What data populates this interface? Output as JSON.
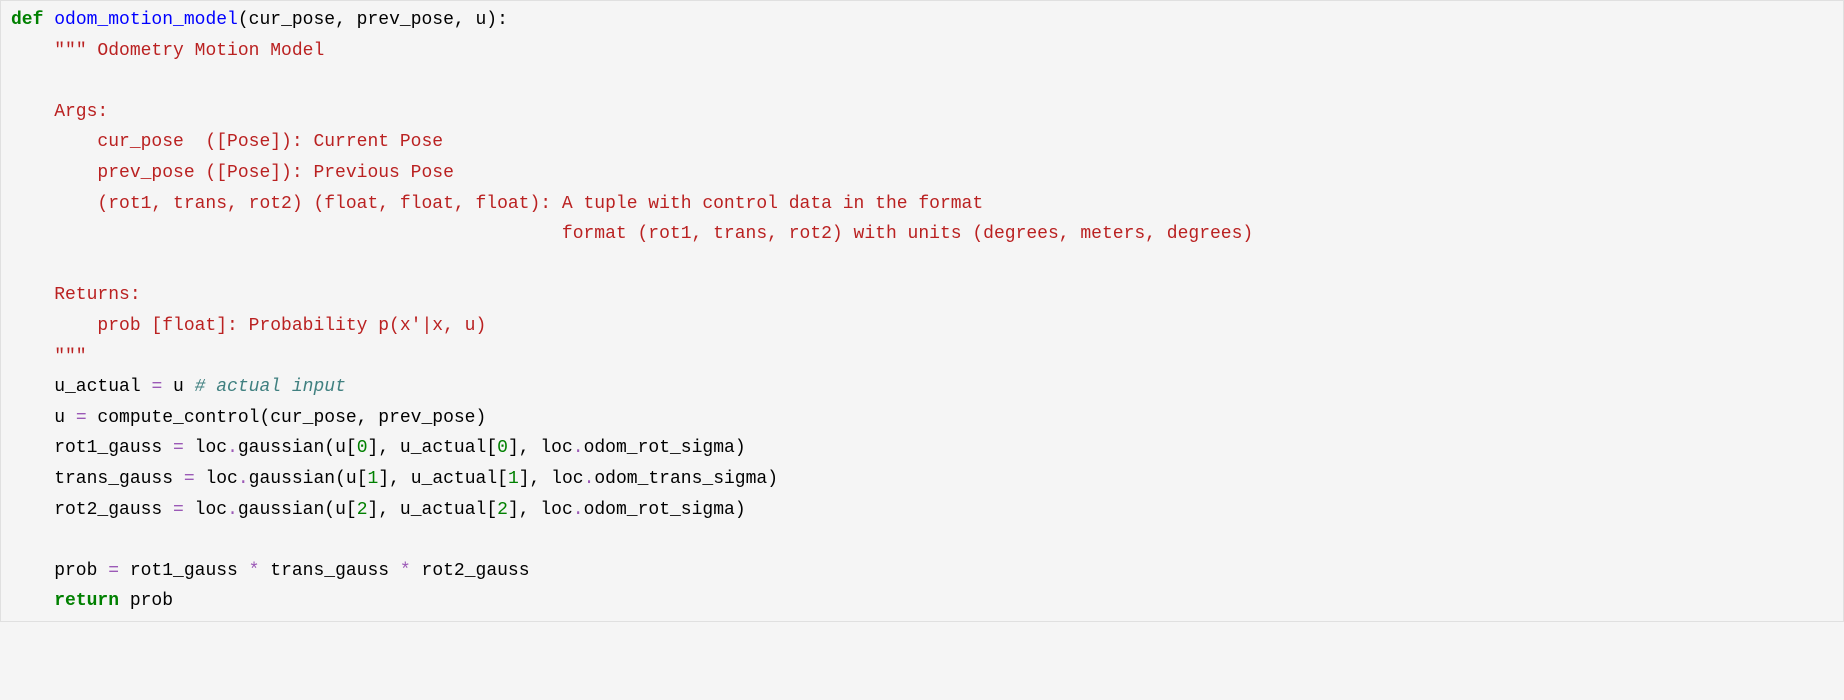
{
  "code": {
    "def_kw": "def",
    "fn_name": "odom_motion_model",
    "params": "(cur_pose, prev_pose, u):",
    "docstring_open": "\"\"\" Odometry Motion Model",
    "args_label": "    Args:",
    "arg1": "        cur_pose  ([Pose]): Current Pose",
    "arg2": "        prev_pose ([Pose]): Previous Pose",
    "arg3": "        (rot1, trans, rot2) (float, float, float): A tuple with control data in the format",
    "arg3b": "                                                   format (rot1, trans, rot2) with units (degrees, meters, degrees)",
    "returns_label": "    Returns:",
    "returns_val": "        prob [float]: Probability p(x'|x, u)",
    "docstring_close": "    \"\"\"",
    "l1_a": "    u_actual ",
    "l1_op": "=",
    "l1_b": " u ",
    "l1_com": "# actual input",
    "l2_a": "    u ",
    "l2_op": "=",
    "l2_b": " compute_control(cur_pose, prev_pose)",
    "l3_a": "    rot1_gauss ",
    "l3_op": "=",
    "l3_b": " loc",
    "l3_dot1": ".",
    "l3_gauss": "gaussian",
    "l3_c": "(u[",
    "l3_n0": "0",
    "l3_d": "], u_actual[",
    "l3_n0b": "0",
    "l3_e": "], loc",
    "l3_dot2": ".",
    "l3_attr": "odom_rot_sigma",
    "l3_f": ")",
    "l4_a": "    trans_gauss ",
    "l4_op": "=",
    "l4_b": " loc",
    "l4_dot1": ".",
    "l4_gauss": "gaussian",
    "l4_c": "(u[",
    "l4_n1": "1",
    "l4_d": "], u_actual[",
    "l4_n1b": "1",
    "l4_e": "], loc",
    "l4_dot2": ".",
    "l4_attr": "odom_trans_sigma",
    "l4_f": ")",
    "l5_a": "    rot2_gauss ",
    "l5_op": "=",
    "l5_b": " loc",
    "l5_dot1": ".",
    "l5_gauss": "gaussian",
    "l5_c": "(u[",
    "l5_n2": "2",
    "l5_d": "], u_actual[",
    "l5_n2b": "2",
    "l5_e": "], loc",
    "l5_dot2": ".",
    "l5_attr": "odom_rot_sigma",
    "l5_f": ")",
    "l6_a": "    prob ",
    "l6_op1": "=",
    "l6_b": " rot1_gauss ",
    "l6_op2": "*",
    "l6_c": " trans_gauss ",
    "l6_op3": "*",
    "l6_d": " rot2_gauss",
    "l7_kw": "return",
    "l7_a": "    ",
    "l7_b": " prob"
  }
}
